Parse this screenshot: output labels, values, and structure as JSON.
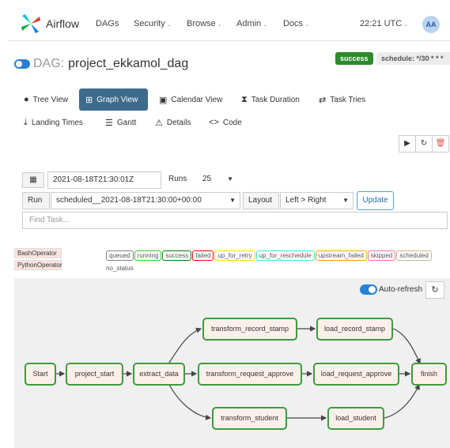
{
  "navbar": {
    "brand": "Airflow",
    "items": [
      {
        "label": "DAGs",
        "caret": false
      },
      {
        "label": "Security",
        "caret": true
      },
      {
        "label": "Browse",
        "caret": true
      },
      {
        "label": "Admin",
        "caret": true
      },
      {
        "label": "Docs",
        "caret": true
      }
    ],
    "clock": "22:21 UTC",
    "avatar": "AA"
  },
  "dag": {
    "prefix": "DAG:",
    "name": "project_ekkamol_dag",
    "status": "success",
    "schedule": "schedule: */30 * * *"
  },
  "tabs": {
    "tree": "Tree View",
    "graph": "Graph View",
    "calendar": "Calendar View",
    "duration": "Task Duration",
    "tries": "Task Tries",
    "landing": "Landing Times",
    "gantt": "Gantt",
    "details": "Details",
    "code": "Code"
  },
  "form": {
    "date": "2021-08-18T21:30:01Z",
    "runs_label": "Runs",
    "runs_value": "25",
    "run_label": "Run",
    "run_value": "scheduled__2021-08-18T21:30:00+00:00",
    "layout_label": "Layout",
    "layout_value": "Left > Right",
    "update": "Update",
    "find_placeholder": "Find Task..."
  },
  "legend": {
    "operators": [
      "BashOperator",
      "PythonOperator"
    ],
    "statuses": [
      "queued",
      "running",
      "success",
      "failed",
      "up_for_retry",
      "up_for_reschedule",
      "upstream_failed",
      "skipped",
      "scheduled"
    ],
    "status_colors": [
      "#808080",
      "#32cd32",
      "#008000",
      "#ff0000",
      "#ffd700",
      "#40e0d0",
      "#ffa500",
      "#ff69b4",
      "#d2b48c"
    ],
    "no_status": "no_status"
  },
  "graph": {
    "autorefresh": "Auto-refresh",
    "nodes": {
      "start": "Start",
      "project_start": "project_start",
      "extract_data": "extract_data",
      "transform_record_stamp": "transform_record_stamp",
      "load_record_stamp": "load_record_stamp",
      "transform_request_approve": "transform_request_approve",
      "load_request_approve": "load_request_approve",
      "transform_student": "transform_student",
      "load_student": "load_student",
      "finish": "finish"
    },
    "node_border": "#3e9b3e",
    "node_fill": "#fdf0ea"
  }
}
